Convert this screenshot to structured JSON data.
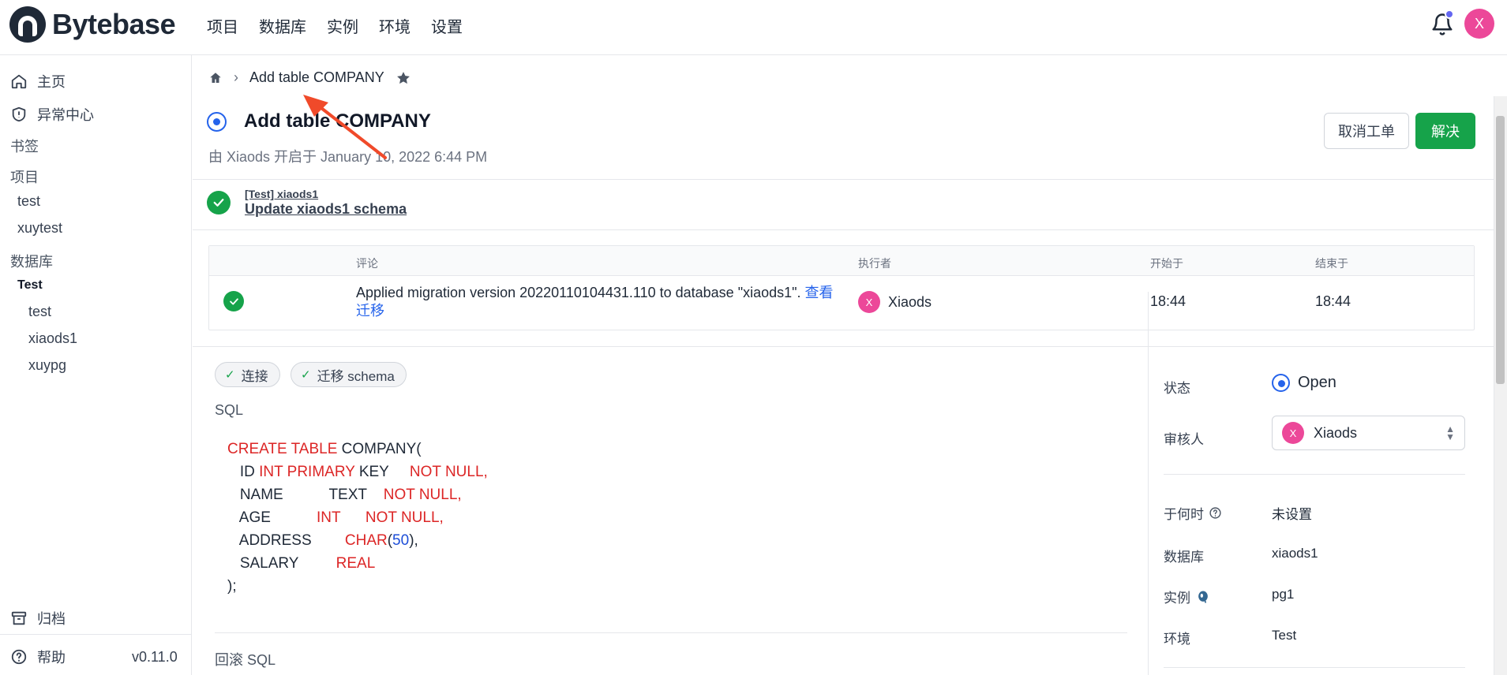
{
  "app": {
    "name": "Bytebase",
    "avatar_initial": "X"
  },
  "nav": {
    "items": [
      "项目",
      "数据库",
      "实例",
      "环境",
      "设置"
    ]
  },
  "sidebar": {
    "home": "主页",
    "anomaly": "异常中心",
    "bookmarks": "书签",
    "projects_header": "项目",
    "projects": [
      "test",
      "xuytest"
    ],
    "databases_header": "数据库",
    "env_group": "Test",
    "databases": [
      "test",
      "xiaods1",
      "xuypg"
    ],
    "archive": "归档",
    "help": "帮助",
    "version": "v0.11.0"
  },
  "breadcrumb": {
    "title": "Add table COMPANY"
  },
  "issue": {
    "title": "Add  table COMPANY",
    "subtitle": "由 Xiaods 开启于 January 10, 2022 6:44 PM",
    "cancel_label": "取消工单",
    "resolve_label": "解决"
  },
  "task": {
    "env": "[Test] xiaods1",
    "name": "Update xiaods1 schema"
  },
  "run_table": {
    "headers": {
      "comment": "评论",
      "executor": "执行者",
      "start": "开始于",
      "end": "结束于"
    },
    "row": {
      "comment": "Applied migration version 20220110104431.110 to database \"xiaods1\".",
      "link1": "查看",
      "link2": "迁移",
      "executor": "Xiaods",
      "executor_initial": "X",
      "start": "18:44",
      "end": "18:44"
    }
  },
  "chips": {
    "connect": "连接",
    "migrate": "迁移 schema"
  },
  "sql": {
    "label": "SQL",
    "rollback_label": "回滚 SQL",
    "lines": {
      "l1_kw": "CREATE TABLE",
      "l1_rest": " COMPANY(",
      "l2_a": "   ID ",
      "l2_kw": "INT PRIMARY",
      "l2_b": " KEY     ",
      "l2_kw2": "NOT NULL,",
      "l3_a": "   NAME           TEXT    ",
      "l3_kw": "NOT NULL,",
      "l4_a": "   AGE           ",
      "l4_kw": "INT      NOT NULL,",
      "l5_a": "   ADDRESS        ",
      "l5_kw": "CHAR",
      "l5_p1": "(",
      "l5_num": "50",
      "l5_p2": "),",
      "l6_a": "   SALARY         ",
      "l6_kw": "REAL",
      "l7": ");"
    }
  },
  "right_panel": {
    "status_label": "状态",
    "status_value": "Open",
    "reviewer_label": "审核人",
    "reviewer_value": "Xiaods",
    "reviewer_initial": "X",
    "when_label": "于何时",
    "when_value": "未设置",
    "database_label": "数据库",
    "database_value": "xiaods1",
    "instance_label": "实例",
    "instance_value": "pg1",
    "env_label": "环境",
    "env_value": "Test"
  },
  "colors": {
    "accent": "#2563eb",
    "success": "#16a34a",
    "danger": "#dc2626",
    "avatar": "#ec4899",
    "annotation_arrow": "#f04a2a"
  }
}
